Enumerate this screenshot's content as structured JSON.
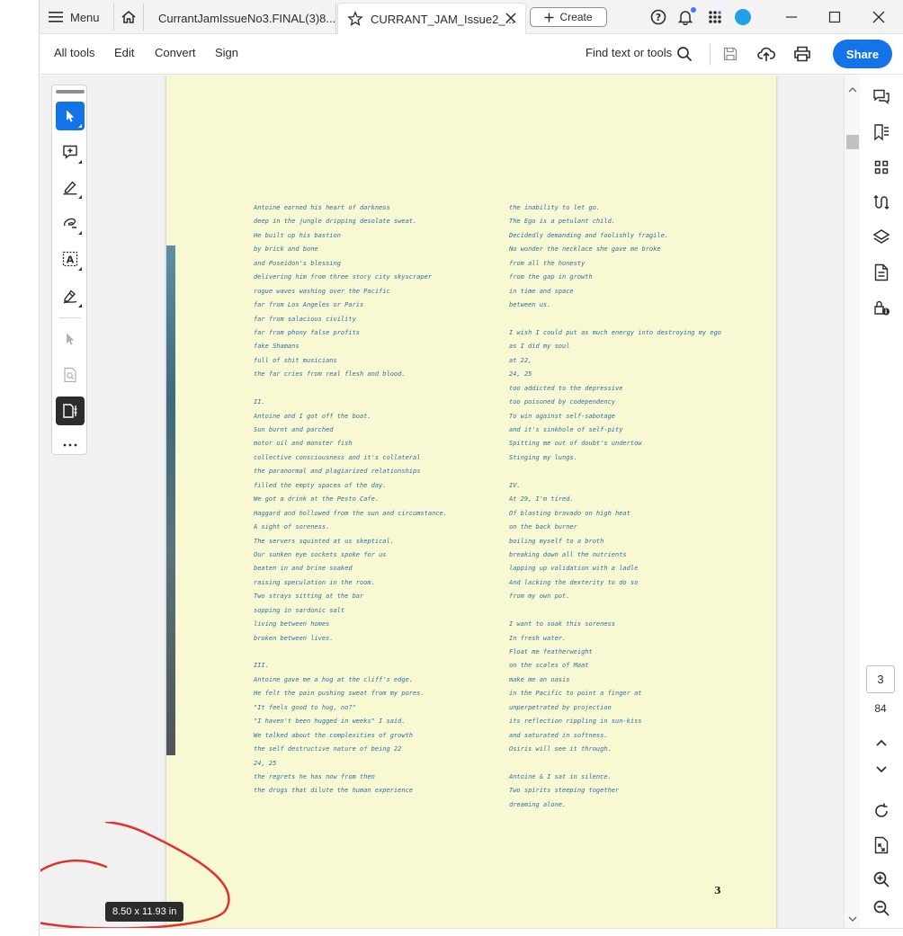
{
  "titlebar": {
    "menu_label": "Menu",
    "tabs": [
      {
        "label": "CurrantJamIssueNo3.FINAL(3)8..."
      },
      {
        "label": "CURRANT_JAM_Issue2_..."
      }
    ],
    "create_label": "Create"
  },
  "toolbar": {
    "items": [
      "All tools",
      "Edit",
      "Convert",
      "Sign"
    ],
    "find_label": "Find text or tools",
    "share_label": "Share"
  },
  "document": {
    "left_column": [
      "Antoine earned his heart of darkness",
      "deep in the jungle dripping desolate sweat.",
      "He built up his bastion",
      "by brick and bone",
      "and Poseidon's blessing",
      "delivering him from three story city skyscraper",
      "rogue waves washing over the Pacific",
      "far from Los Angeles or Paris",
      "far from salacious civility",
      "far from phony false profits",
      "fake Shamans",
      "full of shit musicians",
      "the far cries from real flesh and blood.",
      "",
      "II.",
      "Antoine and I got off the boat.",
      "Sun burnt and parched",
      "motor oil and monster fish",
      "collective consciousness and it's collateral",
      "the paranormal and plagiarized relationships",
      "filled the empty spaces of the day.",
      "We got a drink at the Pesto Cafe.",
      "Haggard and hollowed from the sun and circumstance.",
      "A sight of soreness.",
      "The servers squinted at us skeptical.",
      "Our sunken eye sockets spoke for us",
      "beaten in and brine soaked",
      "raising speculation in the room.",
      "Two strays sitting at the bar",
      "sopping in sardonic salt",
      "living between homes",
      "broken between lives.",
      "",
      "III.",
      "Antoine gave me a hug at the cliff's edge.",
      "He felt the pain pushing sweat from my pores.",
      "\"It feels good to hug, no?\"",
      "\"I haven't been hugged in weeks\" I said.",
      "We talked about the complexities of growth",
      "the self destructive nature of being 22",
      "24, 25",
      "the regrets he has now from then",
      "the drugs that dilute the human experience"
    ],
    "right_column": [
      "the inability to let go.",
      "The Ego is a petulant child.",
      "Decidedly demanding and foolishly fragile.",
      "No wonder the necklace she gave me broke",
      "from all the honesty",
      "from the gap in growth",
      "in time and space",
      "between us.",
      "",
      "I wish I could put as much energy into destroying my ego",
      "as I did my soul",
      "at 22,",
      "24, 25",
      "too addicted to the depressive",
      "too poisoned by codependency",
      "To win against self-sabotage",
      "and it's sinkhole of self-pity",
      "Spitting me out of doubt's undertow",
      "Stinging my lungs.",
      "",
      "IV.",
      "At 29, I'm tired.",
      "Of blasting bravado on high heat",
      "on the back burner",
      "boiling myself to a broth",
      "breaking down all the nutrients",
      "lapping up validation with a ladle",
      "And lacking the dexterity to do so",
      "from my own pot.",
      "",
      "I want to soak this soreness",
      "In fresh water.",
      "Float me featherweight",
      "on the scales of Maat",
      "make me an oasis",
      "in the Pacific to point a finger at",
      "unperpetrated by projection",
      "its reflection rippling in sun-kiss",
      "and saturated in softness.",
      "Osiris will see it through.",
      "",
      "Antoine & I sat in silence.",
      "Two spirits steeping together",
      "dreaming alone."
    ],
    "page_number": "3",
    "size_badge": "8.50 x 11.93 in"
  },
  "navigation": {
    "current_page": "3",
    "total_pages": "84"
  },
  "colors": {
    "accent": "#1473e6",
    "page_bg": "#f8f8d3",
    "poem_text": "#2773a8",
    "annotation_red": "#e0322d"
  }
}
